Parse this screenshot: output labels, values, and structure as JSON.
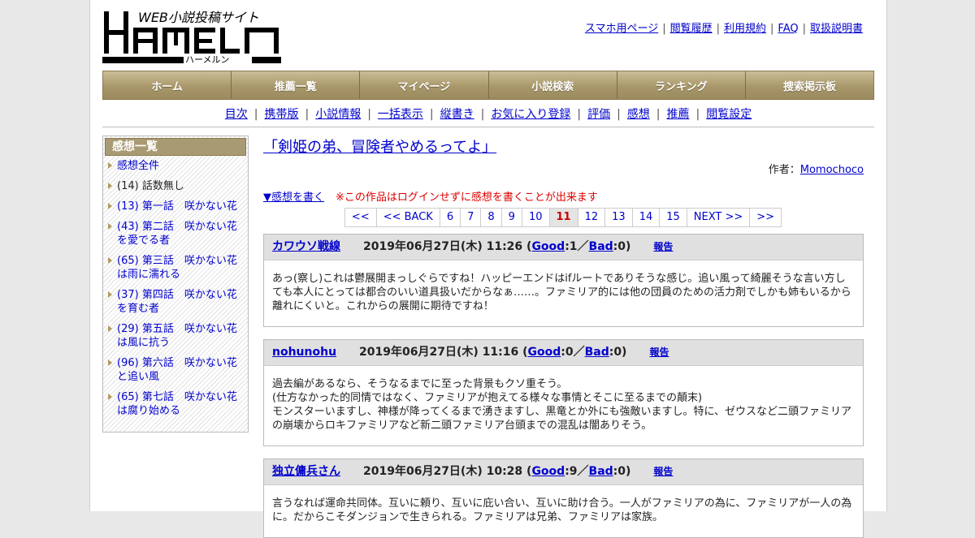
{
  "logo": {
    "tagline": "WEB小説投稿サイト",
    "name": "HAMELN",
    "kana": "ハーメルン"
  },
  "toplinks": [
    "スマホ用ページ",
    "閲覧履歴",
    "利用規約",
    "FAQ",
    "取扱説明書"
  ],
  "mainnav": [
    "ホーム",
    "推薦一覧",
    "マイページ",
    "小説検索",
    "ランキング",
    "捜索掲示板"
  ],
  "subnav": [
    "目次",
    "携帯版",
    "小説情報",
    "一括表示",
    "縦書き",
    "お気に入り登録",
    "評価",
    "感想",
    "推薦",
    "閲覧設定"
  ],
  "sidebar": {
    "title": "感想一覧",
    "items": [
      {
        "label": "感想全件",
        "link": true
      },
      {
        "label": "(14) 話数無し",
        "link": false
      },
      {
        "label": "(13) 第一話　咲かない花",
        "link": true
      },
      {
        "label": "(43) 第二話　咲かない花を愛でる者",
        "link": true
      },
      {
        "label": "(65) 第三話　咲かない花は雨に濡れる",
        "link": true
      },
      {
        "label": "(37) 第四話　咲かない花を育む者",
        "link": true
      },
      {
        "label": "(29) 第五話　咲かない花は風に抗う",
        "link": true
      },
      {
        "label": "(96) 第六話　咲かない花と追い風",
        "link": true
      },
      {
        "label": "(65) 第七話　咲かない花は腐り始める",
        "link": true
      }
    ]
  },
  "novel": {
    "title": "「剣姫の弟、冒険者やめるってよ」",
    "author_label": "作者：",
    "author": "Momochoco"
  },
  "write": {
    "link": "▼感想を書く",
    "warning": "※この作品はログインせずに感想を書くことが出来ます"
  },
  "pager": {
    "items": [
      "<<",
      "<< BACK",
      "6",
      "7",
      "8",
      "9",
      "10",
      "11",
      "12",
      "13",
      "14",
      "15",
      "NEXT >>",
      ">>"
    ],
    "current": "11"
  },
  "reviews": [
    {
      "user": "カワウソ戦線",
      "date": "2019年06月27日(木) 11:26",
      "good": "1",
      "bad": "0",
      "report": "報告",
      "lines": [
        "あっ(察し)これは鬱展開まっしぐらですね！ハッピーエンドはifルートでありそうな感じ。追い風って綺麗そうな言い方しても本人にとっては都合のいい道具扱いだからなぁ……。ファミリア的には他の団員のための活力剤でしかも姉もいるから離れにくいと。これからの展開に期待ですね！"
      ]
    },
    {
      "user": "nohunohu",
      "date": "2019年06月27日(木) 11:16",
      "good": "0",
      "bad": "0",
      "report": "報告",
      "lines": [
        "過去編があるなら、そうなるまでに至った背景もクソ重そう。",
        "(仕方なかった的同情ではなく、ファミリアが抱えてる様々な事情とそこに至るまでの顛末)",
        "モンスターいますし、神様が降ってくるまで湧きますし、黒竜とか外にも強敵いますし。特に、ゼウスなど二頭ファミリアの崩壊からロキファミリアなど新二頭ファミリア台頭までの混乱は闇ありそう。"
      ]
    },
    {
      "user": "独立傭兵さん",
      "date": "2019年06月27日(木) 10:28",
      "good": "9",
      "bad": "0",
      "report": "報告",
      "lines": [
        "言うなれば運命共同体。互いに頼り、互いに庇い合い、互いに助け合う。一人がファミリアの為に、ファミリアが一人の為に。だからこそダンジョンで生きられる。ファミリアは兄弟、ファミリアは家族。"
      ]
    }
  ],
  "labels": {
    "good": "Good",
    "bad": "Bad"
  }
}
